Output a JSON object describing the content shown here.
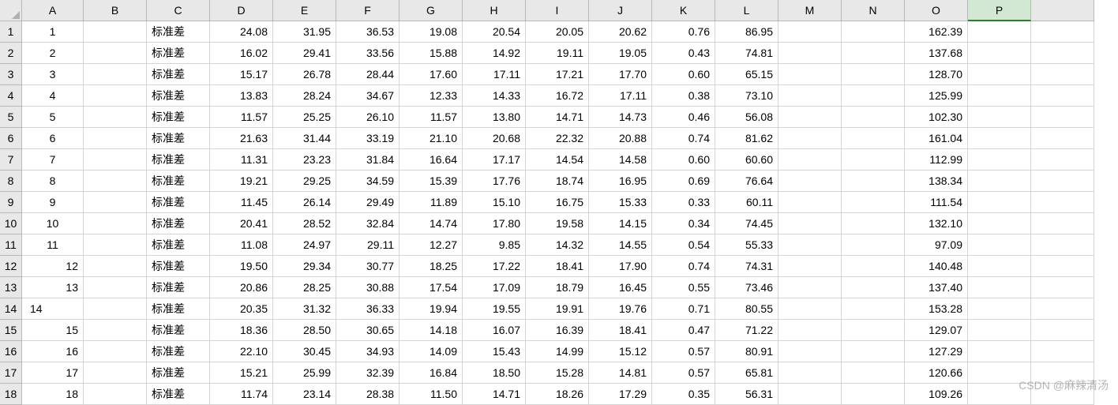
{
  "columns": [
    "A",
    "B",
    "C",
    "D",
    "E",
    "F",
    "G",
    "H",
    "I",
    "J",
    "K",
    "L",
    "M",
    "N",
    "O",
    "P"
  ],
  "selected_column_index": 15,
  "row_headers": [
    "1",
    "2",
    "3",
    "4",
    "5",
    "6",
    "7",
    "8",
    "9",
    "10",
    "11",
    "12",
    "13",
    "14",
    "15",
    "16",
    "17",
    "18"
  ],
  "col_A_alignment": [
    "center",
    "center",
    "center",
    "center",
    "center",
    "center",
    "center",
    "center",
    "center",
    "center",
    "center",
    "right",
    "right",
    "left",
    "right",
    "right",
    "right",
    "right"
  ],
  "label_stddev": "标准差",
  "rows": [
    {
      "A": "1",
      "C": "标准差",
      "D": "24.08",
      "E": "31.95",
      "F": "36.53",
      "G": "19.08",
      "H": "20.54",
      "I": "20.05",
      "J": "20.62",
      "K": "0.76",
      "L": "86.95",
      "O": "162.39"
    },
    {
      "A": "2",
      "C": "标准差",
      "D": "16.02",
      "E": "29.41",
      "F": "33.56",
      "G": "15.88",
      "H": "14.92",
      "I": "19.11",
      "J": "19.05",
      "K": "0.43",
      "L": "74.81",
      "O": "137.68"
    },
    {
      "A": "3",
      "C": "标准差",
      "D": "15.17",
      "E": "26.78",
      "F": "28.44",
      "G": "17.60",
      "H": "17.11",
      "I": "17.21",
      "J": "17.70",
      "K": "0.60",
      "L": "65.15",
      "O": "128.70"
    },
    {
      "A": "4",
      "C": "标准差",
      "D": "13.83",
      "E": "28.24",
      "F": "34.67",
      "G": "12.33",
      "H": "14.33",
      "I": "16.72",
      "J": "17.11",
      "K": "0.38",
      "L": "73.10",
      "O": "125.99"
    },
    {
      "A": "5",
      "C": "标准差",
      "D": "11.57",
      "E": "25.25",
      "F": "26.10",
      "G": "11.57",
      "H": "13.80",
      "I": "14.71",
      "J": "14.73",
      "K": "0.46",
      "L": "56.08",
      "O": "102.30"
    },
    {
      "A": "6",
      "C": "标准差",
      "D": "21.63",
      "E": "31.44",
      "F": "33.19",
      "G": "21.10",
      "H": "20.68",
      "I": "22.32",
      "J": "20.88",
      "K": "0.74",
      "L": "81.62",
      "O": "161.04"
    },
    {
      "A": "7",
      "C": "标准差",
      "D": "11.31",
      "E": "23.23",
      "F": "31.84",
      "G": "16.64",
      "H": "17.17",
      "I": "14.54",
      "J": "14.58",
      "K": "0.60",
      "L": "60.60",
      "O": "112.99"
    },
    {
      "A": "8",
      "C": "标准差",
      "D": "19.21",
      "E": "29.25",
      "F": "34.59",
      "G": "15.39",
      "H": "17.76",
      "I": "18.74",
      "J": "16.95",
      "K": "0.69",
      "L": "76.64",
      "O": "138.34"
    },
    {
      "A": "9",
      "C": "标准差",
      "D": "11.45",
      "E": "26.14",
      "F": "29.49",
      "G": "11.89",
      "H": "15.10",
      "I": "16.75",
      "J": "15.33",
      "K": "0.33",
      "L": "60.11",
      "O": "111.54"
    },
    {
      "A": "10",
      "C": "标准差",
      "D": "20.41",
      "E": "28.52",
      "F": "32.84",
      "G": "14.74",
      "H": "17.80",
      "I": "19.58",
      "J": "14.15",
      "K": "0.34",
      "L": "74.45",
      "O": "132.10"
    },
    {
      "A": "11",
      "C": "标准差",
      "D": "11.08",
      "E": "24.97",
      "F": "29.11",
      "G": "12.27",
      "H": "9.85",
      "I": "14.32",
      "J": "14.55",
      "K": "0.54",
      "L": "55.33",
      "O": "97.09"
    },
    {
      "A": "12",
      "C": "标准差",
      "D": "19.50",
      "E": "29.34",
      "F": "30.77",
      "G": "18.25",
      "H": "17.22",
      "I": "18.41",
      "J": "17.90",
      "K": "0.74",
      "L": "74.31",
      "O": "140.48"
    },
    {
      "A": "13",
      "C": "标准差",
      "D": "20.86",
      "E": "28.25",
      "F": "30.88",
      "G": "17.54",
      "H": "17.09",
      "I": "18.79",
      "J": "16.45",
      "K": "0.55",
      "L": "73.46",
      "O": "137.40"
    },
    {
      "A": "14",
      "C": "标准差",
      "D": "20.35",
      "E": "31.32",
      "F": "36.33",
      "G": "19.94",
      "H": "19.55",
      "I": "19.91",
      "J": "19.76",
      "K": "0.71",
      "L": "80.55",
      "O": "153.28"
    },
    {
      "A": "15",
      "C": "标准差",
      "D": "18.36",
      "E": "28.50",
      "F": "30.65",
      "G": "14.18",
      "H": "16.07",
      "I": "16.39",
      "J": "18.41",
      "K": "0.47",
      "L": "71.22",
      "O": "129.07"
    },
    {
      "A": "16",
      "C": "标准差",
      "D": "22.10",
      "E": "30.45",
      "F": "34.93",
      "G": "14.09",
      "H": "15.43",
      "I": "14.99",
      "J": "15.12",
      "K": "0.57",
      "L": "80.91",
      "O": "127.29"
    },
    {
      "A": "17",
      "C": "标准差",
      "D": "15.21",
      "E": "25.99",
      "F": "32.39",
      "G": "16.84",
      "H": "18.50",
      "I": "15.28",
      "J": "14.81",
      "K": "0.57",
      "L": "65.81",
      "O": "120.66"
    },
    {
      "A": "18",
      "C": "标准差",
      "D": "11.74",
      "E": "23.14",
      "F": "28.38",
      "G": "11.50",
      "H": "14.71",
      "I": "18.26",
      "J": "17.29",
      "K": "0.35",
      "L": "56.31",
      "O": "109.26"
    }
  ],
  "watermark": "CSDN @麻辣清汤"
}
